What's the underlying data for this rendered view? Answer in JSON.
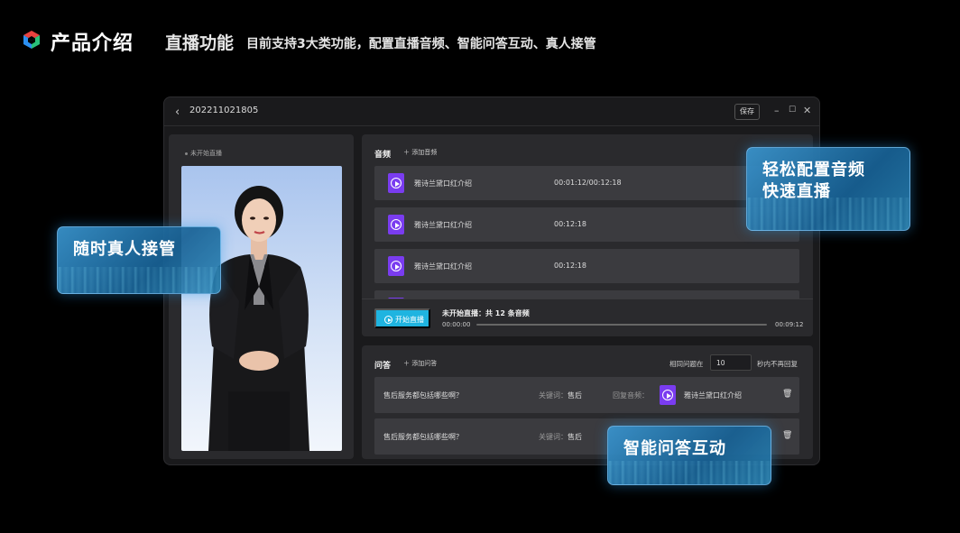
{
  "header": {
    "brand": "产品介绍",
    "section_title": "直播功能",
    "section_subtitle": "目前支持3大类功能，配置直播音频、智能问答互动、真人接管"
  },
  "window": {
    "title": "202211021805",
    "save_label": "保存"
  },
  "left_panel": {
    "status": "未开始直播"
  },
  "audio": {
    "heading": "音频",
    "add_label": "添加音频",
    "rows": [
      {
        "name": "雅诗兰黛口红介绍",
        "time": "00:01:12/00:12:18"
      },
      {
        "name": "雅诗兰黛口红介绍",
        "time": "00:12:18"
      },
      {
        "name": "雅诗兰黛口红介绍",
        "time": "00:12:18"
      }
    ],
    "start_button": "开始直播",
    "live_status": "未开始直播：共 12 条音频",
    "time_start": "00:00:00",
    "time_end": "00:09:12",
    "progress": 0
  },
  "qa": {
    "heading": "问答",
    "add_label": "添加问答",
    "same_label": "相同问题在",
    "interval_value": "10",
    "tail_label": "秒内不再回复",
    "rows": [
      {
        "question": "售后服务都包括哪些啊？",
        "kw_label": "关键词：",
        "keyword": "售后",
        "reply_label": "回复音频：",
        "file": "雅诗兰黛口红介绍"
      },
      {
        "question": "售后服务都包括哪些啊？",
        "kw_label": "关键词：",
        "keyword": "售后"
      }
    ]
  },
  "callouts": {
    "takeover": "随时真人接管",
    "audio_line1": "轻松配置音频",
    "audio_line2": "快速直播",
    "qa": "智能问答互动"
  },
  "colors": {
    "accent": "#1fb4e0",
    "file_icon": "#7a3cf0"
  }
}
